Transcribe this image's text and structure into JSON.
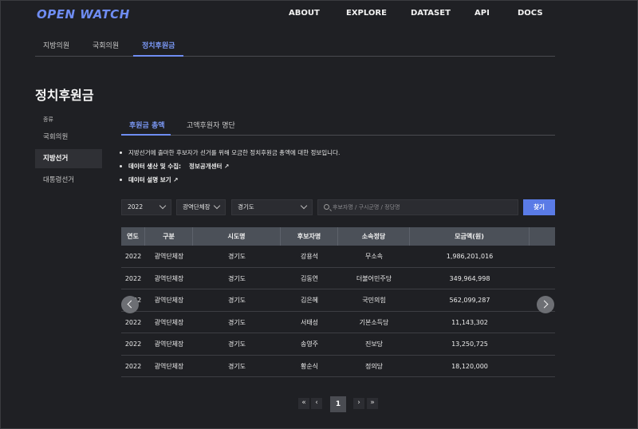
{
  "header": {
    "logo": "OPEN WATCH",
    "nav": [
      "ABOUT",
      "EXPLORE",
      "DATASET",
      "API",
      "DOCS"
    ]
  },
  "subtabs": [
    "지방의원",
    "국회의원",
    "정치후원금"
  ],
  "page_title": "정치후원금",
  "sidebar": {
    "heading": "종류",
    "items": [
      "국회의원",
      "지방선거",
      "대통령선거"
    ]
  },
  "content_tabs": [
    "후원금 총액",
    "고액후원자 명단"
  ],
  "info": {
    "line1": "지방선거에 출마한 후보자가 선거를 위해 모금한 정치후원금 총액에 대한 정보입니다.",
    "line2_label": "데이터 생산 및 수집:",
    "line2_link": "정보공개센터 ↗",
    "line3_link": "데이터 설명 보기 ↗"
  },
  "filters": {
    "year": "2022",
    "category": "광역단체장",
    "region": "경기도",
    "search_placeholder": "후보자명 / 구시군명 / 정당명",
    "search_button": "찾기"
  },
  "table": {
    "headers": [
      "연도",
      "구분",
      "시도명",
      "후보자명",
      "소속정당",
      "모금액(원)",
      ""
    ],
    "rows": [
      [
        "2022",
        "광역단체장",
        "경기도",
        "강용석",
        "무소속",
        "1,986,201,016"
      ],
      [
        "2022",
        "광역단체장",
        "경기도",
        "김동연",
        "더불어민주당",
        "349,964,998"
      ],
      [
        "2022",
        "광역단체장",
        "경기도",
        "김은혜",
        "국민의힘",
        "562,099,287"
      ],
      [
        "2022",
        "광역단체장",
        "경기도",
        "서태성",
        "기본소득당",
        "11,143,302"
      ],
      [
        "2022",
        "광역단체장",
        "경기도",
        "송영주",
        "진보당",
        "13,250,725"
      ],
      [
        "2022",
        "광역단체장",
        "경기도",
        "황순식",
        "정의당",
        "18,120,000"
      ]
    ]
  },
  "pagination": {
    "first": "«",
    "prev": "‹",
    "current": "1",
    "next": "›",
    "last": "»"
  },
  "colors": {
    "accent": "#6f8df3",
    "button": "#5a7be6",
    "background": "#1f2024"
  }
}
